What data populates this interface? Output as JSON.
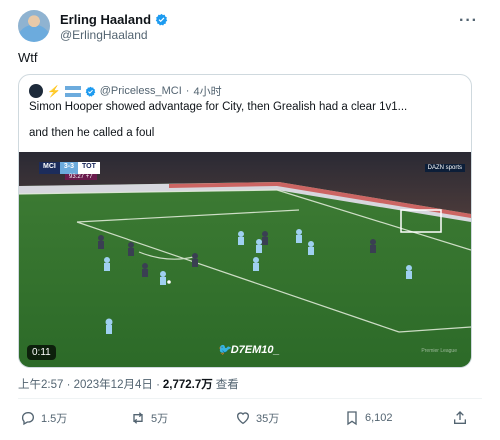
{
  "author": {
    "display_name": "Erling Haaland",
    "handle": "@ErlingHaaland"
  },
  "tweet": {
    "text": "Wtf"
  },
  "quote": {
    "emoji": "⚡️",
    "handle": "@Priceless_MCI",
    "separator": "·",
    "time": "4小时",
    "text_line1": "Simon Hooper showed advantage for City, then Grealish had a clear 1v1...",
    "text_line2": "and then he called a foul",
    "video": {
      "duration": "0:11",
      "watermark": "D7EM10_",
      "scorebug": {
        "home": "MCI",
        "score": "3-3",
        "away": "TOT",
        "clock": "93:27",
        "added": "+7"
      },
      "broadcaster": "DAZN sports",
      "league_mark": "Premier League"
    }
  },
  "meta": {
    "timestamp": "上午2:57 · 2023年12月4日 ·",
    "views_count": "2,772.7万",
    "views_label": "查看"
  },
  "actions": {
    "replies": "1.5万",
    "retweets": "5万",
    "likes": "35万",
    "bookmarks": "6,102"
  },
  "colors": {
    "verified": "#1d9bf0",
    "muted": "#536471",
    "pitch": "#2f6b2c"
  }
}
